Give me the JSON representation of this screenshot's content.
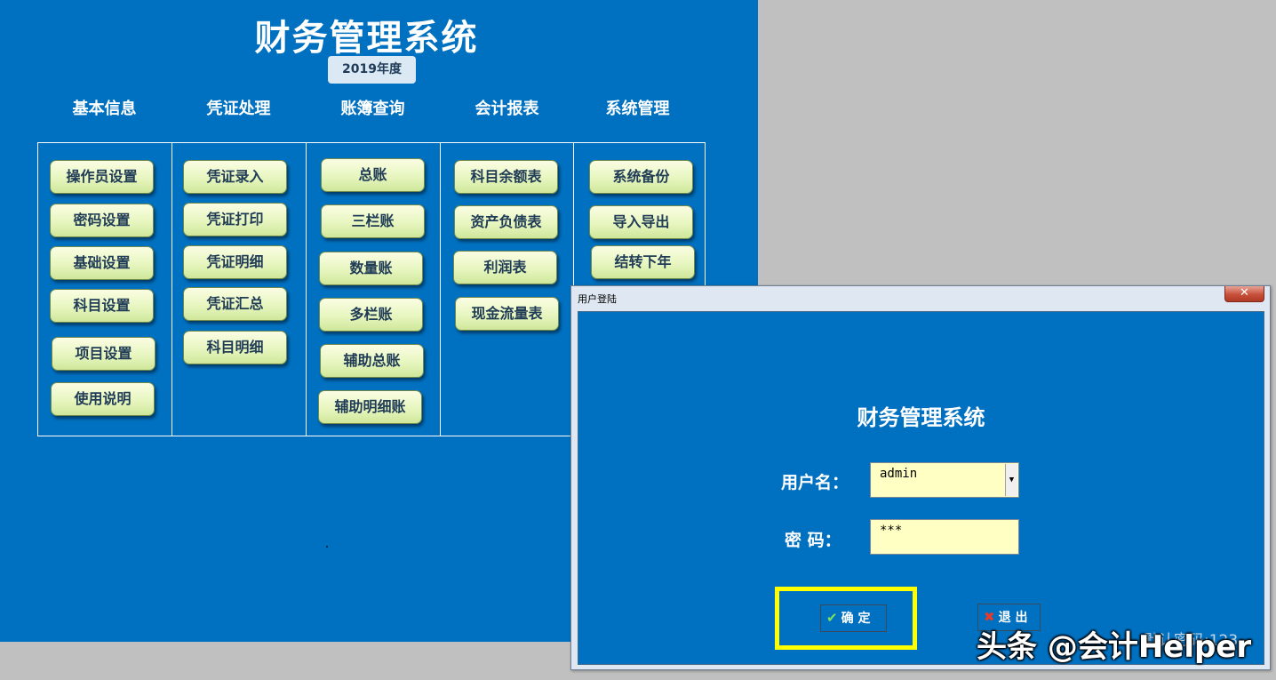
{
  "app": {
    "title": "财务管理系统",
    "year": "2019年度"
  },
  "columns": [
    {
      "header": "基本信息",
      "buttons": [
        "操作员设置",
        "密码设置",
        "基础设置",
        "科目设置",
        "项目设置",
        "使用说明"
      ]
    },
    {
      "header": "凭证处理",
      "buttons": [
        "凭证录入",
        "凭证打印",
        "凭证明细",
        "凭证汇总",
        "科目明细"
      ]
    },
    {
      "header": "账簿查询",
      "buttons": [
        "总账",
        "三栏账",
        "数量账",
        "多栏账",
        "辅助总账",
        "辅助明细账"
      ]
    },
    {
      "header": "会计报表",
      "buttons": [
        "科目余额表",
        "资产负债表",
        "利润表",
        "现金流量表"
      ]
    },
    {
      "header": "系统管理",
      "buttons": [
        "系统备份",
        "导入导出",
        "结转下年"
      ]
    }
  ],
  "login": {
    "window_title": "用户登陆",
    "close_icon": "close-icon",
    "heading": "财务管理系统",
    "username_label": "用户名：",
    "username_value": "admin",
    "password_label": "密  码：",
    "password_value": "***",
    "ok_label": "确 定",
    "ok_icon": "check-icon",
    "exit_label": "退 出",
    "exit_icon": "x-icon",
    "version_text": "默认密码:123"
  },
  "watermark": "头条 @会计Helper",
  "colors": {
    "panel_bg": "#0070c0",
    "button_bg": "#e7f6bf",
    "field_bg": "#ffffc4",
    "highlight": "#ffff00",
    "desktop_bg": "#c0c0c0"
  }
}
